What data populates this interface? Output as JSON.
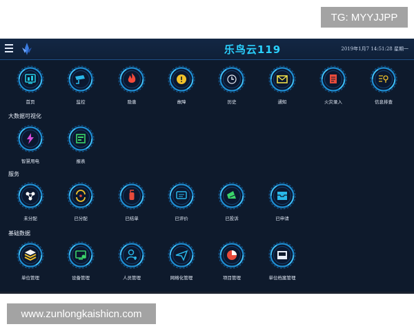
{
  "watermarks": {
    "top": "TG: MYYJJPP",
    "bottom": "www.zunlongkaishicn.com"
  },
  "header": {
    "title": "乐鸟云119",
    "datetime": "2019年1月7 14:51:28 星期一"
  },
  "colors": {
    "background": "#0e1a2c",
    "accent": "#2ad1ff",
    "ring": "#1f8fd4"
  },
  "sections": [
    {
      "title": "",
      "items": [
        {
          "label": "首页",
          "icon": "monitor-icon",
          "color": "#24c7e0"
        },
        {
          "label": "监控",
          "icon": "camera-icon",
          "color": "#29b6e8"
        },
        {
          "label": "隐患",
          "icon": "fire-icon",
          "color": "#f24a3b"
        },
        {
          "label": "故障",
          "icon": "warning-icon",
          "color": "#f0c12a"
        },
        {
          "label": "历史",
          "icon": "clock-icon",
          "color": "#e8eef8"
        },
        {
          "label": "通知",
          "icon": "mail-icon",
          "color": "#f0e04a"
        },
        {
          "label": "火灾录入",
          "icon": "form-icon",
          "color": "#e84a3b"
        },
        {
          "label": "信息排查",
          "icon": "search-list-icon",
          "color": "#f0c12a"
        }
      ]
    },
    {
      "title": "大数据可视化",
      "items": [
        {
          "label": "智慧用电",
          "icon": "power-icon",
          "color": "#d24ad8"
        },
        {
          "label": "报表",
          "icon": "report-icon",
          "color": "#3bd46a"
        }
      ]
    },
    {
      "title": "服务",
      "items": [
        {
          "label": "未分配",
          "icon": "nodes-icon",
          "color": "#ffffff"
        },
        {
          "label": "已分配",
          "icon": "assign-icon",
          "color": "#f0c12a"
        },
        {
          "label": "已结单",
          "icon": "fire-extinguisher-icon",
          "color": "#e84a3b"
        },
        {
          "label": "已评价",
          "icon": "comment-icon",
          "color": "#29b6e8"
        },
        {
          "label": "已投诉",
          "icon": "megaphone-icon",
          "color": "#3bd46a"
        },
        {
          "label": "已申请",
          "icon": "inbox-icon",
          "color": "#29b6e8"
        }
      ]
    },
    {
      "title": "基础数据",
      "items": [
        {
          "label": "单位管理",
          "icon": "layers-icon",
          "color": "#f0c12a"
        },
        {
          "label": "设备管理",
          "icon": "device-icon",
          "color": "#3bd46a"
        },
        {
          "label": "人员管理",
          "icon": "person-icon",
          "color": "#29b6e8"
        },
        {
          "label": "网格化管理",
          "icon": "paper-plane-icon",
          "color": "#29b6e8"
        },
        {
          "label": "项目管理",
          "icon": "pie-icon",
          "color": "#e84a3b"
        },
        {
          "label": "单位档案管理",
          "icon": "folder-icon",
          "color": "#e8eef8"
        }
      ]
    }
  ]
}
